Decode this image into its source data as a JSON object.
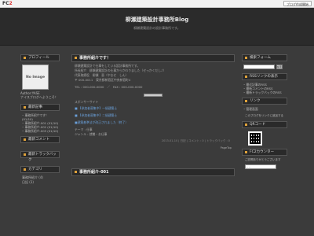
{
  "fc2": {
    "logo_prefix": "FC",
    "logo_suffix": "2",
    "blog_button": "ブログ作成開始"
  },
  "header": {
    "title": "柳瀬建築設計事務所Blog",
    "subtitle": "柳瀬建築設計の設計事務所です。"
  },
  "left": {
    "profile_title": "プロフィール",
    "no_image": "No Image",
    "author": "Author:YASE",
    "welcome": "ナイスブログへようこそ！",
    "recent_title": "最新記事",
    "recent_items": [
      "事務所紹介です！ (01/10)",
      "事務所紹介-001 (01/10)",
      "事務所紹介-002 (01/10)",
      "事務所紹介-003 (01/10)"
    ],
    "comments_title": "最新コメント",
    "trackback_title": "最新トラックバック",
    "category_title": "カテゴリ",
    "category_items": [
      "事務所紹介 (4)",
      "日記 (1)"
    ]
  },
  "entry": {
    "title": "事務所紹介です！",
    "lines": [
      "柳瀬建築設計で仕事をしている設計事務所です。",
      "所長紹介　柳瀬建築設計の仕事からかわりました（せっかくだし♪）",
      "代表取締役　柳瀬　晋（やなせ　しん）",
      "〒 000-0011　東京都新宿区中央新宿町4"
    ],
    "tel": "TEL : 000-000-0000　／　FAX : 000-000-0000",
    "sub_label": "スポンサーサイト",
    "links": [
      "■ 【参加者募集中】一級建築士",
      "■ 【参加者募集中】二級建築士",
      "■建築基準法が改正されました（終了）"
    ],
    "theme": "テーマ : 仕事",
    "genre": "ジャンル : 就職・お仕事",
    "footer": "2013-01-10 | 日記 | コメント : 0 | トラックバック : 0",
    "pagetop": "PageTop",
    "next_title": "事務所紹介-001"
  },
  "right": {
    "search_title": "検索フォーム",
    "search_button": "検索",
    "rss_title": "RSSリンクの表示",
    "rss_items": [
      "最近記事のRSS",
      "最新コメントのRSS",
      "最新トラックバックのRSS"
    ],
    "links_title": "リンク",
    "links_items": [
      "管理画面"
    ],
    "links_note": "このブログをリンクに追加する",
    "qr_title": "QRコード",
    "counter_title": "FC2カウンター",
    "counter_note": "ご訪問ありがとうございます",
    "select_placeholder": "-- --"
  }
}
